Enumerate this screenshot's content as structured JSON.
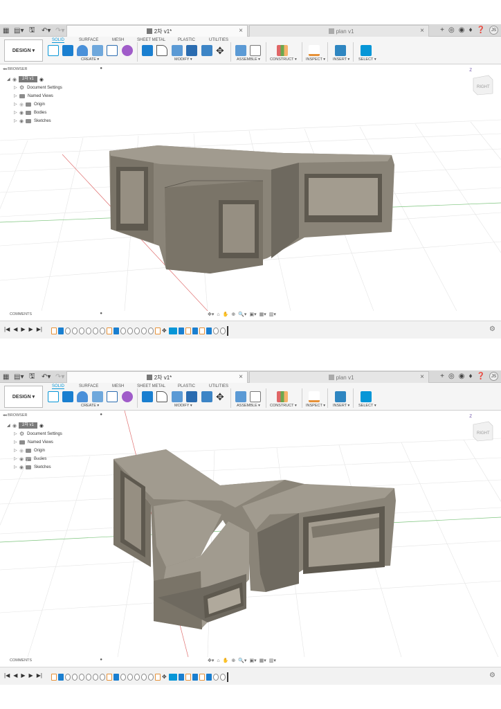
{
  "app": {
    "active_tab_title": "2차 v1*",
    "inactive_tab_title": "plan v1",
    "user_initials": "JS"
  },
  "ribbon": {
    "mode_button": "DESIGN ▾",
    "tabs": [
      "SOLID",
      "SURFACE",
      "MESH",
      "SHEET METAL",
      "PLASTIC",
      "UTILITIES"
    ],
    "groups": [
      "CREATE ▾",
      "MODIFY ▾",
      "ASSEMBLE ▾",
      "CONSTRUCT ▾",
      "INSPECT ▾",
      "INSERT ▾",
      "SELECT ▾"
    ]
  },
  "browser": {
    "header": "BROWSER",
    "root": "2차 v1",
    "items": [
      "Document Settings",
      "Named Views",
      "Origin",
      "Bodies",
      "Sketches"
    ]
  },
  "viewcube": {
    "face_label": "RIGHT",
    "axis_label": "Z"
  },
  "comments": {
    "label": "COMMENTS"
  },
  "colors": {
    "accent": "#0696d7",
    "body": "#8a8478",
    "body_dark": "#6e695f",
    "body_light": "#a19b8f"
  }
}
